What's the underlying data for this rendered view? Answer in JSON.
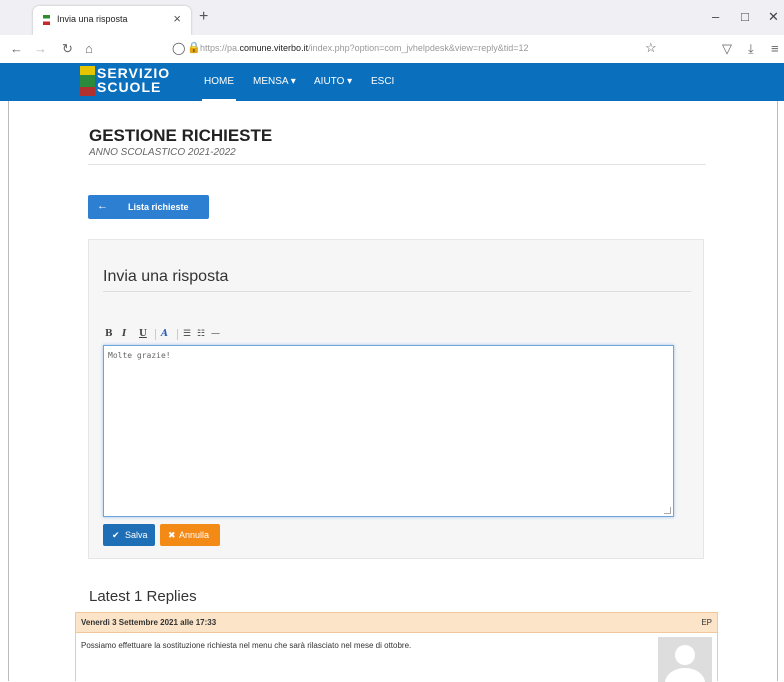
{
  "browser": {
    "tab_title": "Invia una risposta",
    "tab_close": "×",
    "new_tab": "+",
    "url_prefix": "https://pa.",
    "url_domain": "comune.viterbo.it",
    "url_rest": "/index.php?option=com_jvhelpdesk&view=reply&tid=12"
  },
  "site": {
    "logo_line1": "SERVIZIO",
    "logo_line2": "SCUOLE",
    "menu": [
      "HOME",
      "MENSA ▾",
      "AIUTO ▾",
      "ESCI"
    ]
  },
  "page": {
    "title": "GESTIONE RICHIESTE",
    "subtitle": "ANNO SCOLASTICO 2021-2022",
    "list_button": "Lista richieste"
  },
  "reply_form": {
    "title": "Invia una risposta",
    "toolbar": [
      "B",
      "I",
      "U",
      "A",
      "☰",
      "☷",
      "—"
    ],
    "editor_value": "Molte grazie!",
    "save_label": "Salva",
    "cancel_label": "Annulla"
  },
  "replies": {
    "heading": "Latest 1 Replies",
    "items": [
      {
        "date": "Venerdì 3 Settembre 2021 alle 17:33",
        "initials": "EP",
        "message": "Possiamo effettuare la sostituzione richiesta nel menu che sarà rilasciato nel mese di ottobre."
      }
    ]
  },
  "colors": {
    "header": "#0a6fbd",
    "save": "#1f6fb6",
    "cancel": "#f48a16",
    "reply_head": "#fbe4c8"
  }
}
